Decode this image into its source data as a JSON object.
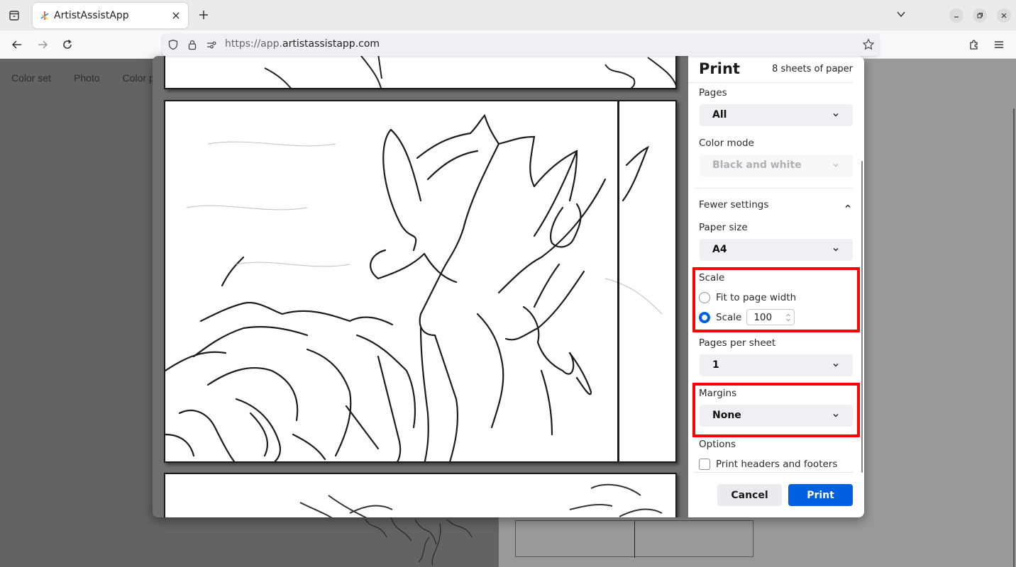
{
  "browser": {
    "tab": {
      "title": "ArtistAssistApp",
      "close_icon": "close-icon"
    },
    "new_tab_label": "+",
    "url": {
      "scheme_prefix": "https://app.",
      "host": "artistassistapp.com"
    },
    "icons": {
      "tab_list": "tab-list-icon",
      "back": "arrow-left-icon",
      "forward": "arrow-right-icon",
      "reload": "reload-icon",
      "shield": "shield-icon",
      "lock": "lock-icon",
      "permissions": "permissions-icon",
      "bookmark": "star-icon",
      "extensions": "puzzle-icon",
      "menu": "hamburger-icon",
      "tabs_dropdown": "chevron-down-icon",
      "minimize": "minimize-icon",
      "maximize": "restore-icon",
      "close_window": "close-icon"
    }
  },
  "page": {
    "nav": [
      "Color set",
      "Photo",
      "Color p"
    ]
  },
  "print_dialog": {
    "title": "Print",
    "sheet_count": "8 sheets of paper",
    "pages": {
      "label": "Pages",
      "value": "All"
    },
    "color_mode": {
      "label": "Color mode",
      "value": "Black and white",
      "disabled": true
    },
    "fewer_settings": "Fewer settings",
    "paper_size": {
      "label": "Paper size",
      "value": "A4"
    },
    "scale": {
      "label": "Scale",
      "options": [
        {
          "label": "Fit to page width",
          "selected": false
        },
        {
          "label": "Scale",
          "selected": true
        }
      ],
      "value": "100"
    },
    "pages_per_sheet": {
      "label": "Pages per sheet",
      "value": "1"
    },
    "margins": {
      "label": "Margins",
      "value": "None"
    },
    "options": {
      "label": "Options",
      "print_headers_footers": {
        "label": "Print headers and footers",
        "checked": false
      }
    },
    "buttons": {
      "cancel": "Cancel",
      "print": "Print"
    },
    "accent_color": "#0061e0",
    "highlight_color": "#ff0000"
  }
}
